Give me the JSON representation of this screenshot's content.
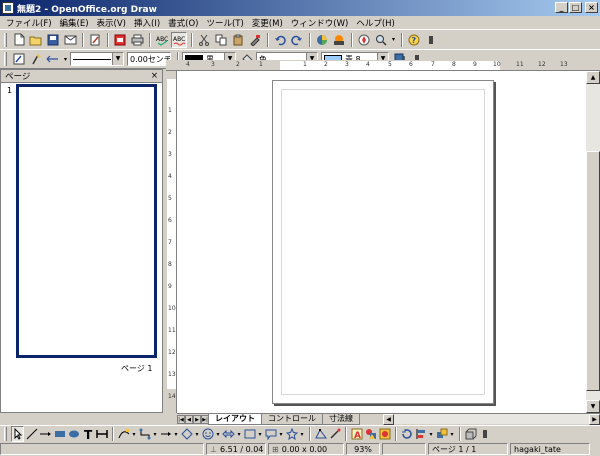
{
  "window": {
    "title": "無題2 - OpenOffice.org Draw",
    "buttons": [
      "_",
      "□",
      "×"
    ]
  },
  "menu": [
    "ファイル(F)",
    "編集(E)",
    "表示(V)",
    "挿入(I)",
    "書式(O)",
    "ツール(T)",
    "変更(M)",
    "ウィンドウ(W)",
    "ヘルプ(H)"
  ],
  "toolbar2": {
    "line_width": "0.00センチ",
    "line_color": "黒",
    "line_color_hex": "#000000",
    "area_style": "色",
    "area_color": "青 8",
    "area_color_hex": "#99ccff"
  },
  "pages_panel": {
    "title": "ページ",
    "close": "×",
    "page_number": "1",
    "page_label": "ページ 1"
  },
  "ruler_h": [
    "4",
    "3",
    "2",
    "1",
    "1",
    "2",
    "3",
    "4",
    "5",
    "6",
    "7",
    "8",
    "9",
    "10",
    "11",
    "12",
    "13"
  ],
  "ruler_v": [
    "1",
    "2",
    "3",
    "4",
    "5",
    "6",
    "7",
    "8",
    "9",
    "10",
    "11",
    "12",
    "13",
    "14"
  ],
  "tabs": [
    "レイアウト",
    "コントロール",
    "寸法線"
  ],
  "status": {
    "position": "6.51 / 0.04",
    "size": "0.00 x 0.00",
    "zoom": "93%",
    "page": "ページ 1 / 1",
    "layout_name": "hagaki_tate"
  }
}
